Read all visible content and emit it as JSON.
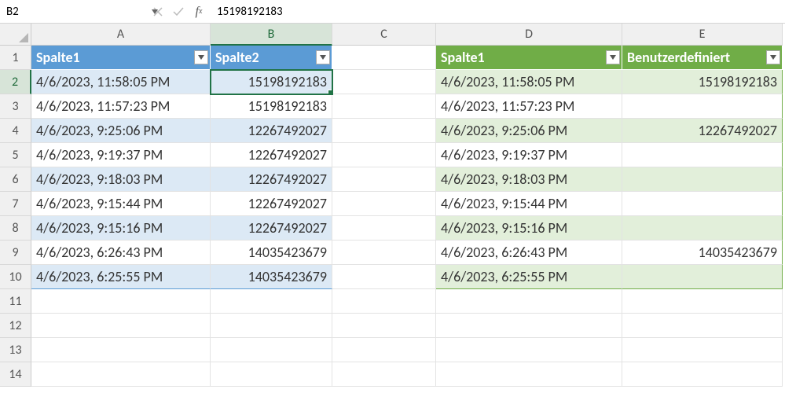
{
  "formula_bar": {
    "name_box": "B2",
    "formula": "15198192183"
  },
  "columns": [
    "A",
    "B",
    "C",
    "D",
    "E"
  ],
  "active_column_index": 1,
  "rows": [
    "1",
    "2",
    "3",
    "4",
    "5",
    "6",
    "7",
    "8",
    "9",
    "10",
    "11",
    "12",
    "13",
    "14"
  ],
  "active_row_index": 1,
  "blue_table": {
    "headers": [
      "Spalte1",
      "Spalte2"
    ],
    "rows": [
      {
        "c0": "4/6/2023, 11:58:05 PM",
        "c1": "15198192183"
      },
      {
        "c0": "4/6/2023, 11:57:23 PM",
        "c1": "15198192183"
      },
      {
        "c0": "4/6/2023, 9:25:06 PM",
        "c1": "12267492027"
      },
      {
        "c0": "4/6/2023, 9:19:37 PM",
        "c1": "12267492027"
      },
      {
        "c0": "4/6/2023, 9:18:03 PM",
        "c1": "12267492027"
      },
      {
        "c0": "4/6/2023, 9:15:44 PM",
        "c1": "12267492027"
      },
      {
        "c0": "4/6/2023, 9:15:16 PM",
        "c1": "12267492027"
      },
      {
        "c0": "4/6/2023, 6:26:43 PM",
        "c1": "14035423679"
      },
      {
        "c0": "4/6/2023, 6:25:55 PM",
        "c1": "14035423679"
      }
    ]
  },
  "green_table": {
    "headers": [
      "Spalte1",
      "Benutzerdefiniert"
    ],
    "rows": [
      {
        "c0": "4/6/2023, 11:58:05 PM",
        "c1": "15198192183"
      },
      {
        "c0": "4/6/2023, 11:57:23 PM",
        "c1": ""
      },
      {
        "c0": "4/6/2023, 9:25:06 PM",
        "c1": "12267492027"
      },
      {
        "c0": "4/6/2023, 9:19:37 PM",
        "c1": ""
      },
      {
        "c0": "4/6/2023, 9:18:03 PM",
        "c1": ""
      },
      {
        "c0": "4/6/2023, 9:15:44 PM",
        "c1": ""
      },
      {
        "c0": "4/6/2023, 9:15:16 PM",
        "c1": ""
      },
      {
        "c0": "4/6/2023, 6:26:43 PM",
        "c1": "14035423679"
      },
      {
        "c0": "4/6/2023, 6:25:55 PM",
        "c1": ""
      }
    ]
  }
}
